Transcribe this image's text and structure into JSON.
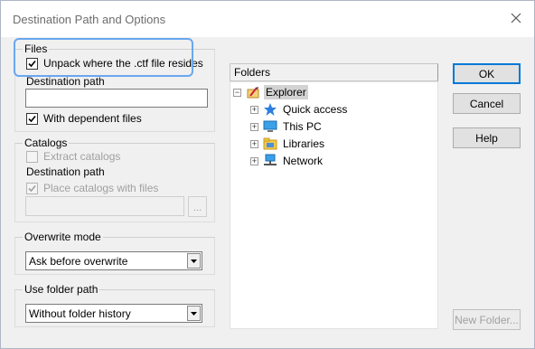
{
  "window": {
    "title": "Destination Path and Options"
  },
  "files": {
    "legend": "Files",
    "unpack_label": "Unpack where the .ctf file resides",
    "unpack_checked": true,
    "dest_path_label": "Destination path",
    "dest_path_value": "",
    "dependent_label": "With dependent files",
    "dependent_checked": true
  },
  "catalogs": {
    "legend": "Catalogs",
    "extract_label": "Extract catalogs",
    "extract_checked": false,
    "dest_path_label": "Destination path",
    "place_label": "Place catalogs with files",
    "place_checked": true,
    "path_value": "",
    "browse_label": "..."
  },
  "overwrite": {
    "legend": "Overwrite mode",
    "selected": "Ask before overwrite"
  },
  "folder_path": {
    "legend": "Use folder path",
    "selected": "Without folder history"
  },
  "folders": {
    "header": "Folders",
    "root": {
      "label": "Explorer",
      "expander": "−",
      "icon": "explorer-icon"
    },
    "items": [
      {
        "label": "Quick access",
        "expander": "+",
        "icon": "quick-access-icon"
      },
      {
        "label": "This PC",
        "expander": "+",
        "icon": "this-pc-icon"
      },
      {
        "label": "Libraries",
        "expander": "+",
        "icon": "libraries-icon"
      },
      {
        "label": "Network",
        "expander": "+",
        "icon": "network-icon"
      }
    ]
  },
  "buttons": {
    "ok": "OK",
    "cancel": "Cancel",
    "help": "Help",
    "new_folder": "New Folder..."
  },
  "colors": {
    "accent": "#0078d7",
    "highlight_ring": "#69a7f0"
  }
}
